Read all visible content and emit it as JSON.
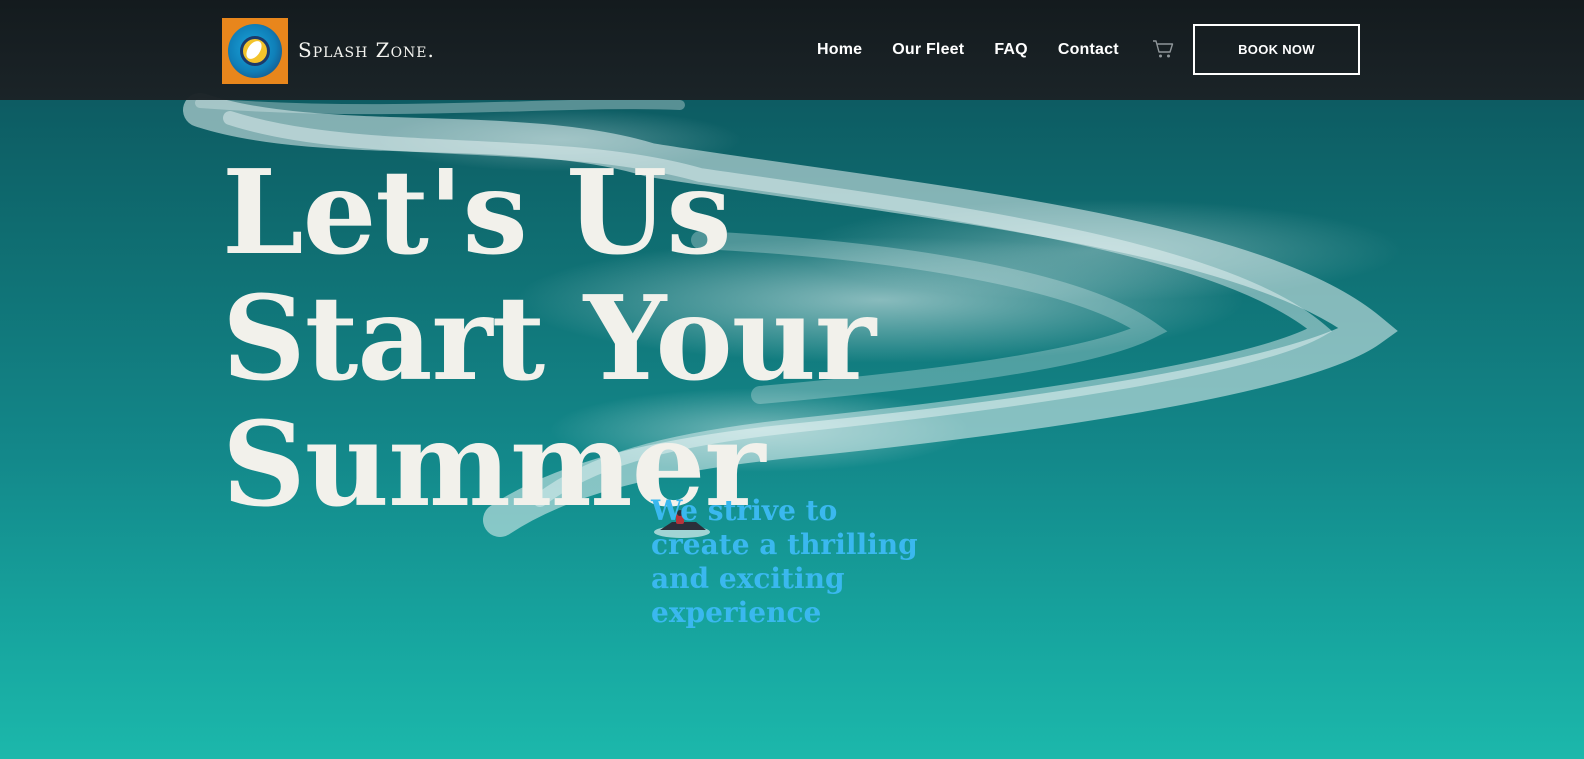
{
  "header": {
    "brand_name": "Splash Zone.",
    "nav": [
      {
        "label": "Home"
      },
      {
        "label": "Our Fleet"
      },
      {
        "label": "FAQ"
      },
      {
        "label": "Contact"
      }
    ],
    "cta_label": "BOOK NOW"
  },
  "hero": {
    "title_lines": [
      "Let's Us",
      "Start Your",
      "Summer"
    ],
    "subtitle": "We strive to create a thrilling and exciting experience"
  },
  "colors": {
    "header_bg": "#14191c",
    "logo_bg": "#e8861c",
    "accent_blue": "#3ab8ef",
    "title_text": "#f2f1eb"
  },
  "icons": {
    "logo": "splash-logo-icon",
    "cart": "cart-icon"
  }
}
